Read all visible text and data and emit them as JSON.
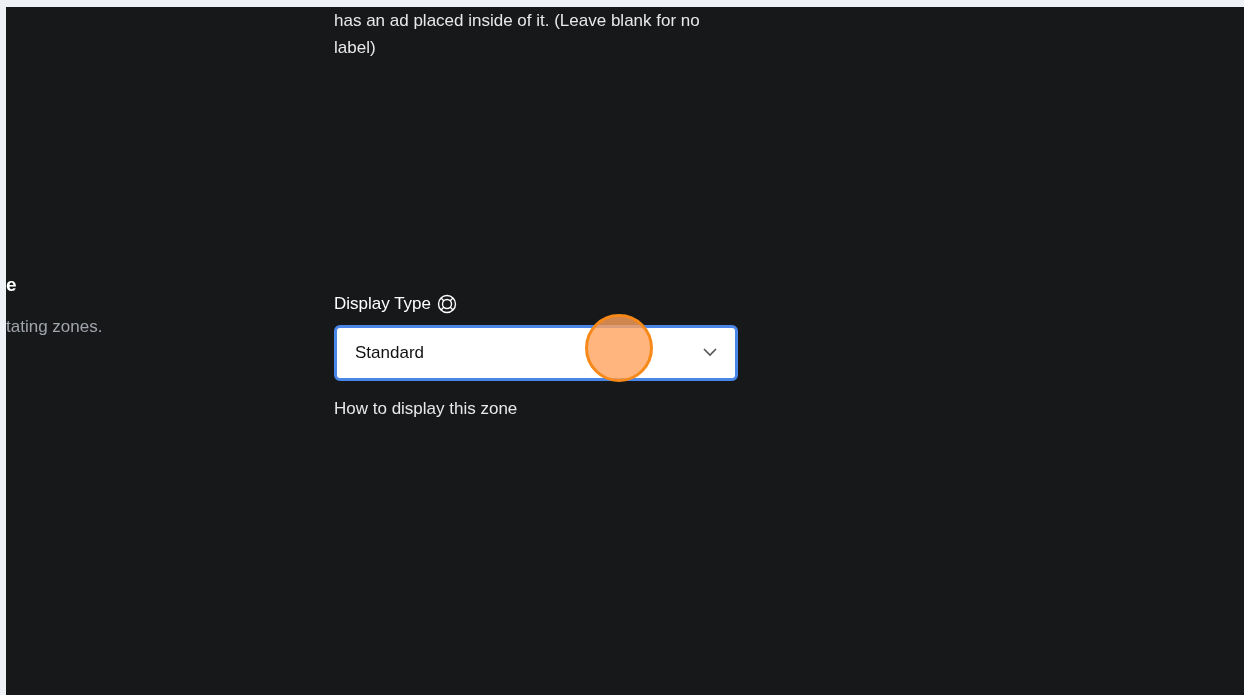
{
  "left_panel": {
    "heading": "e",
    "description": "tating zones."
  },
  "top_help_text": "has an ad placed inside of it. (Leave blank for no label)",
  "display_type": {
    "label": "Display Type",
    "value": "Standard",
    "focused": true,
    "help": "How to display this zone"
  }
}
